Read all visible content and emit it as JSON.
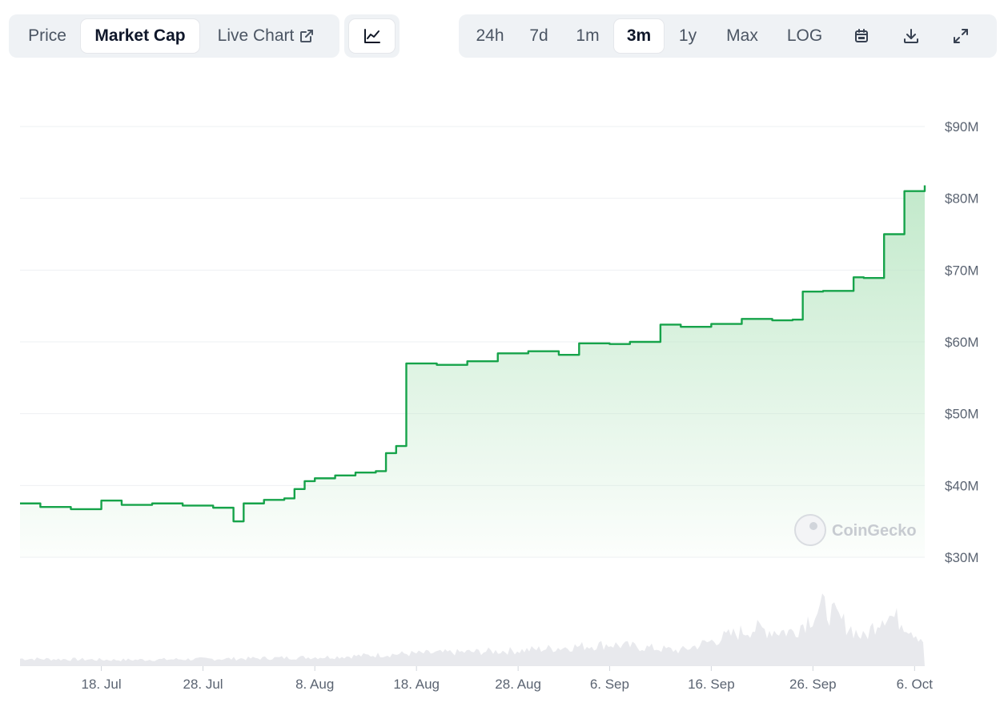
{
  "tabs": {
    "price": "Price",
    "market_cap": "Market Cap",
    "live_chart": "Live Chart",
    "active": "Market Cap"
  },
  "chart_type_icon": "line-chart-icon",
  "ranges": [
    "24h",
    "7d",
    "1m",
    "3m",
    "1y",
    "Max",
    "LOG"
  ],
  "active_range": "3m",
  "toolbar_icons": [
    "calendar-icon",
    "download-icon",
    "expand-icon"
  ],
  "watermark": "CoinGecko",
  "colors": {
    "line": "#16a34a",
    "fill": "#bfe8c8",
    "grid": "#eef0f3",
    "volume": "#e5e7eb"
  },
  "chart_data": {
    "type": "area",
    "title": "",
    "xlabel": "",
    "ylabel": "",
    "x_ticks": [
      "18. Jul",
      "28. Jul",
      "8. Aug",
      "18. Aug",
      "28. Aug",
      "6. Sep",
      "16. Sep",
      "26. Sep",
      "6. Oct"
    ],
    "y_ticks": [
      "$30M",
      "$40M",
      "$50M",
      "$60M",
      "$70M",
      "$80M",
      "$90M"
    ],
    "ylim": [
      30,
      90
    ],
    "y_unit": "millions USD",
    "grid": true,
    "series": [
      {
        "name": "",
        "x": [
          "2024-07-10",
          "2024-07-12",
          "2024-07-15",
          "2024-07-18",
          "2024-07-20",
          "2024-07-23",
          "2024-07-26",
          "2024-07-29",
          "2024-07-31",
          "2024-08-01",
          "2024-08-03",
          "2024-08-05",
          "2024-08-06",
          "2024-08-07",
          "2024-08-08",
          "2024-08-10",
          "2024-08-12",
          "2024-08-14",
          "2024-08-15",
          "2024-08-16",
          "2024-08-17",
          "2024-08-20",
          "2024-08-23",
          "2024-08-26",
          "2024-08-29",
          "2024-09-01",
          "2024-09-03",
          "2024-09-06",
          "2024-09-08",
          "2024-09-11",
          "2024-09-13",
          "2024-09-16",
          "2024-09-19",
          "2024-09-22",
          "2024-09-24",
          "2024-09-25",
          "2024-09-27",
          "2024-09-30",
          "2024-10-01",
          "2024-10-03",
          "2024-10-05",
          "2024-10-07"
        ],
        "values": [
          37.5,
          37.0,
          36.7,
          37.9,
          37.3,
          37.5,
          37.2,
          36.9,
          35.0,
          37.5,
          38.0,
          38.2,
          39.5,
          40.6,
          41.0,
          41.4,
          41.8,
          42.0,
          44.5,
          45.5,
          57.0,
          56.8,
          57.3,
          58.4,
          58.7,
          58.2,
          59.8,
          59.7,
          60.0,
          62.4,
          62.1,
          62.5,
          63.2,
          63.0,
          63.1,
          67.0,
          67.1,
          69.0,
          68.9,
          75.0,
          81.0,
          81.8
        ]
      }
    ],
    "volume_series": {
      "name": "",
      "x": [
        "2024-07-10",
        "2024-07-20",
        "2024-07-31",
        "2024-08-10",
        "2024-08-17",
        "2024-08-28",
        "2024-09-06",
        "2024-09-13",
        "2024-09-20",
        "2024-09-24",
        "2024-09-27",
        "2024-10-01",
        "2024-10-03",
        "2024-10-05",
        "2024-10-07"
      ],
      "values": [
        0.12,
        0.1,
        0.12,
        0.15,
        0.2,
        0.25,
        0.35,
        0.25,
        0.6,
        0.55,
        0.95,
        0.45,
        0.85,
        0.7,
        0.4
      ]
    }
  }
}
